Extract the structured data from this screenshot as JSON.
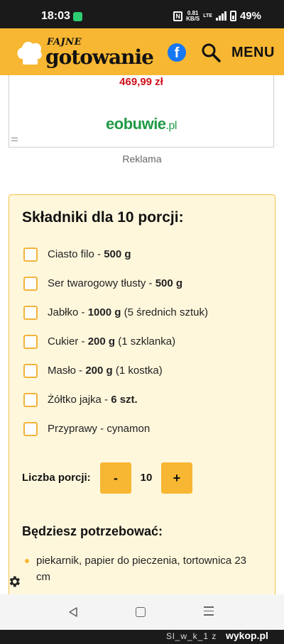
{
  "status_bar": {
    "time": "18:03",
    "net_speed_value": "0.81",
    "net_speed_unit": "KB/S",
    "network_label": "LTE",
    "battery": "49%"
  },
  "header": {
    "logo_small": "FAJNE",
    "logo_big": "gotowanie",
    "facebook_glyph": "f",
    "menu_label": "MENU"
  },
  "ad": {
    "price": "469,99 zł",
    "brand": "eobuwie",
    "brand_suffix": ".pl",
    "caption": "Reklama"
  },
  "ingredients": {
    "title": "Składniki dla 10 porcji:",
    "items": [
      {
        "name": "Ciasto filo - ",
        "amount": "500 g",
        "note": ""
      },
      {
        "name": "Ser twarogowy tłusty - ",
        "amount": "500 g",
        "note": ""
      },
      {
        "name": "Jabłko - ",
        "amount": "1000 g",
        "note": " (5 średnich sztuk)"
      },
      {
        "name": "Cukier - ",
        "amount": "200 g",
        "note": " (1 szklanka)"
      },
      {
        "name": "Masło - ",
        "amount": "200 g",
        "note": " (1 kostka)"
      },
      {
        "name": "Żółtko jajka - ",
        "amount": "6 szt.",
        "note": ""
      },
      {
        "name": "Przyprawy - cynamon",
        "amount": "",
        "note": ""
      }
    ]
  },
  "servings": {
    "label": "Liczba porcji:",
    "minus_label": "-",
    "value": "10",
    "plus_label": "+"
  },
  "needs": {
    "title": "Będziesz potrzebować:",
    "items": [
      "piekarnik, papier do pieczenia, tortownica 23 cm"
    ]
  },
  "watermark": {
    "user": "Sl_w_k_1 z",
    "site": "wykop.pl"
  },
  "colors": {
    "header_bg": "#f7b733",
    "card_bg": "#fff7dc",
    "price_red": "#d0121b",
    "ad_brand_green": "#1f9a46"
  },
  "icons": [
    "message-icon",
    "nfc-icon",
    "signal-icon",
    "battery-icon",
    "chef-hat-icon",
    "facebook-icon",
    "search-icon",
    "gear-icon",
    "back-icon",
    "home-icon",
    "recents-icon"
  ]
}
